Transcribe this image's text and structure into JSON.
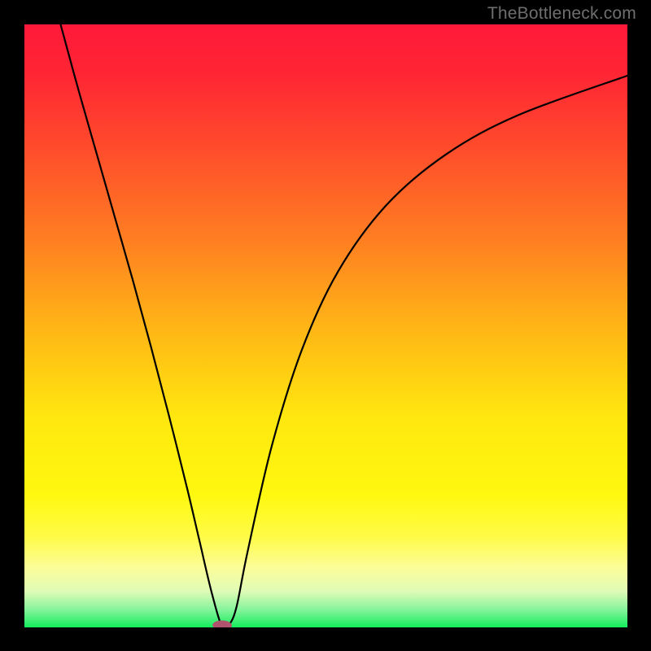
{
  "watermark": "TheBottleneck.com",
  "chart_data": {
    "type": "line",
    "title": "",
    "xlabel": "",
    "ylabel": "",
    "xlim": [
      0,
      1
    ],
    "ylim": [
      0,
      1
    ],
    "gradient_stops": [
      {
        "offset": 0.0,
        "color": "#ff193a"
      },
      {
        "offset": 0.08,
        "color": "#ff2534"
      },
      {
        "offset": 0.2,
        "color": "#ff4a2c"
      },
      {
        "offset": 0.35,
        "color": "#ff7c22"
      },
      {
        "offset": 0.5,
        "color": "#ffb416"
      },
      {
        "offset": 0.65,
        "color": "#ffe70f"
      },
      {
        "offset": 0.78,
        "color": "#fff80f"
      },
      {
        "offset": 0.85,
        "color": "#fffb47"
      },
      {
        "offset": 0.9,
        "color": "#fcfd98"
      },
      {
        "offset": 0.94,
        "color": "#dffbb6"
      },
      {
        "offset": 0.97,
        "color": "#87f49c"
      },
      {
        "offset": 1.0,
        "color": "#13ed5c"
      }
    ],
    "series": [
      {
        "name": "curve",
        "x": [
          0.06,
          0.09,
          0.12,
          0.15,
          0.18,
          0.21,
          0.24,
          0.27,
          0.29,
          0.31,
          0.328,
          0.34,
          0.352,
          0.37,
          0.41,
          0.46,
          0.52,
          0.6,
          0.7,
          0.82,
          1.0
        ],
        "y": [
          1.0,
          0.89,
          0.785,
          0.68,
          0.575,
          0.465,
          0.35,
          0.23,
          0.145,
          0.06,
          0.0,
          0.005,
          0.035,
          0.125,
          0.3,
          0.46,
          0.59,
          0.7,
          0.785,
          0.85,
          0.915
        ]
      }
    ],
    "marker": {
      "x": 0.328,
      "y": 0.0035,
      "rx": 0.016,
      "ry": 0.008,
      "rotation_deg": 1.5,
      "color": "#b0536d"
    }
  }
}
